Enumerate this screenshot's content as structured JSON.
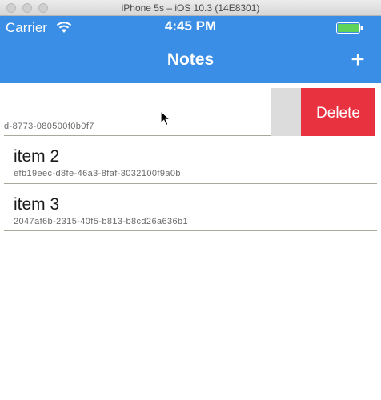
{
  "window": {
    "title": "iPhone 5s – iOS 10.3 (14E8301)"
  },
  "status_bar": {
    "carrier": "Carrier",
    "time": "4:45 PM"
  },
  "nav": {
    "title": "Notes",
    "add_label": "+"
  },
  "list": {
    "rows": [
      {
        "title": "",
        "id": "d-8773-080500f0b0f7"
      },
      {
        "title": "item 2",
        "id": "efb19eec-d8fe-46a3-8faf-3032100f9a0b"
      },
      {
        "title": "item 3",
        "id": "2047af6b-2315-40f5-b813-b8cd26a636b1"
      }
    ],
    "delete_label": "Delete"
  },
  "colors": {
    "accent": "#3a8ee6",
    "delete": "#e8323f",
    "action_gray": "#dcdcdc",
    "battery": "#5fd35a"
  },
  "icons": [
    "wifi-icon",
    "battery-icon",
    "pointer-cursor-icon"
  ]
}
